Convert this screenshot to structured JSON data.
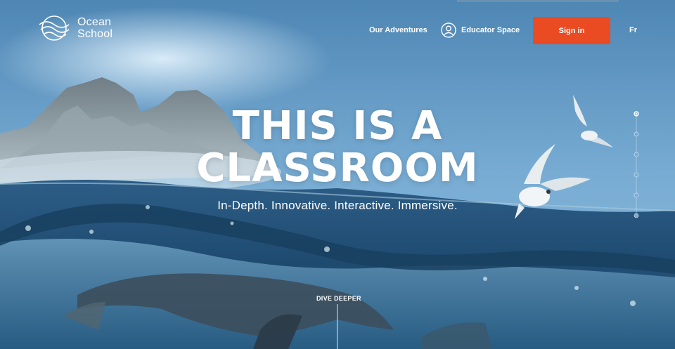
{
  "brand": {
    "line1": "Ocean",
    "line2": "School",
    "icon": "ocean-school-logo-icon"
  },
  "nav": {
    "adventures": "Our Adventures",
    "educator": "Educator Space",
    "educator_icon": "user-circle-icon",
    "signin": "Sign in",
    "language": "Fr"
  },
  "hero": {
    "title_line1": "THIS IS A",
    "title_line2": "CLASSROOM",
    "tagline": "In-Depth. Innovative. Interactive. Immersive."
  },
  "cta": {
    "dive": "DIVE DEEPER"
  },
  "pager": {
    "count": 6,
    "active_index": 0
  },
  "colors": {
    "accent": "#ea4b23",
    "sky": "#6aa3cc",
    "water": "#1f4a6b"
  }
}
